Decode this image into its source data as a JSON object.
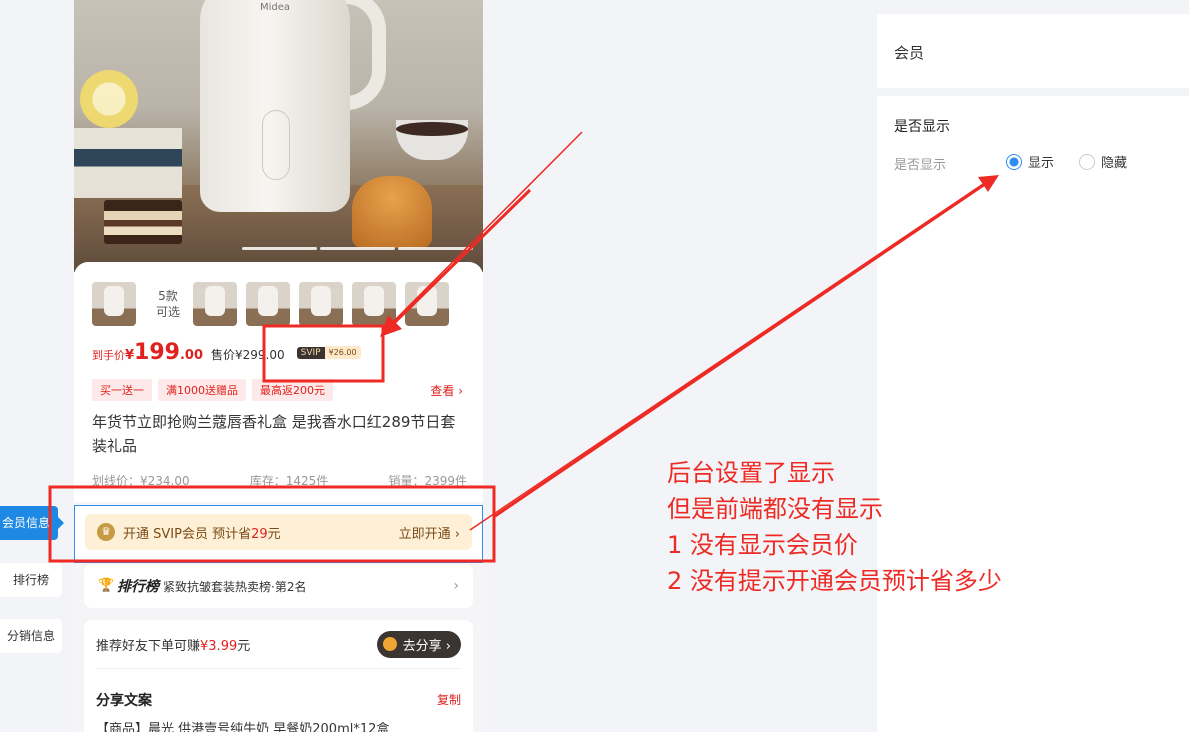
{
  "hero": {
    "brand_logo": "Midea"
  },
  "product": {
    "thumbs_more": [
      "5款",
      "可选"
    ],
    "price_label": "到手价",
    "price_yen": "¥",
    "price_int": "199",
    "price_dec": ".00",
    "sale_price": "售价¥299.00",
    "svip_tag": "SVIP",
    "svip_price": "¥26.00",
    "tags": [
      "买一送一",
      "满1000送赠品",
      "最高返200元"
    ],
    "see_more": "查看 ›",
    "title": "年货节立即抢购兰蔻唇香礼盒 是我香水口红289节日套装礼品",
    "stat_list_price": "划线价：¥234.00",
    "stat_stock": "库存：1425件",
    "stat_sales": "销量：2399件"
  },
  "member": {
    "prefix": "开通 SVIP会员 预计省",
    "save_amount": "29",
    "suffix": "元",
    "open_label": "立即开通 ›"
  },
  "rank": {
    "brand": "排行榜",
    "text": "紧致抗皱套装热卖榜·第2名",
    "arrow": "›"
  },
  "share": {
    "prefix": "推荐好友下单可赚",
    "money": "¥3.99",
    "suffix": "元",
    "button": "去分享 ›",
    "copy_title": "分享文案",
    "copy_button": "复制",
    "copy_body": "【商品】晨光 供港壹号纯牛奶 早餐奶200ml*12盒"
  },
  "side_nav": {
    "member_info": "会员信息",
    "ranking": "排行榜",
    "distribution": "分销信息"
  },
  "settings": {
    "header_title": "会员",
    "section_title": "是否显示",
    "field_label": "是否显示",
    "option_show": "显示",
    "option_hide": "隐藏",
    "selected": "显示"
  },
  "annotation": {
    "lines": [
      "后台设置了显示",
      "但是前端都没有显示",
      "1 没有显示会员价",
      "2 没有提示开通会员预计省多少"
    ],
    "color": "#ee2a24"
  }
}
